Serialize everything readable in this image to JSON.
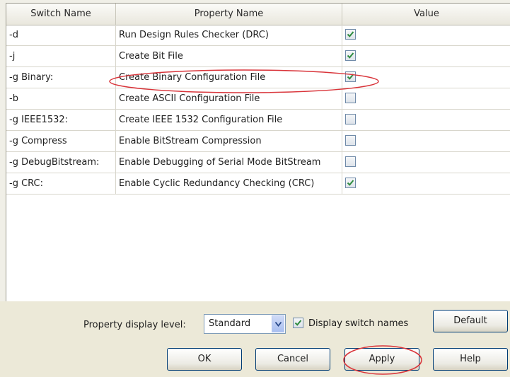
{
  "table": {
    "headers": [
      "Switch Name",
      "Property Name",
      "Value"
    ],
    "rows": [
      {
        "switch": "-d",
        "property": "Run Design Rules Checker (DRC)",
        "checked": true
      },
      {
        "switch": "-j",
        "property": "Create Bit File",
        "checked": true
      },
      {
        "switch": "-g Binary:",
        "property": "Create Binary Configuration File",
        "checked": true
      },
      {
        "switch": "-b",
        "property": "Create ASCII Configuration File",
        "checked": false
      },
      {
        "switch": "-g IEEE1532:",
        "property": "Create IEEE 1532 Configuration File",
        "checked": false
      },
      {
        "switch": "-g Compress",
        "property": "Enable BitStream Compression",
        "checked": false
      },
      {
        "switch": "-g DebugBitstream:",
        "property": "Enable Debugging of Serial Mode BitStream",
        "checked": false
      },
      {
        "switch": "-g CRC:",
        "property": "Enable Cyclic Redundancy Checking (CRC)",
        "checked": true
      }
    ]
  },
  "controls": {
    "display_level_label": "Property display level:",
    "display_level_value": "Standard",
    "display_switch_label": "Display switch names",
    "display_switch_checked": true,
    "default_label": "Default",
    "ok_label": "OK",
    "cancel_label": "Cancel",
    "apply_label": "Apply",
    "help_label": "Help"
  },
  "colors": {
    "annotation": "#d9343a",
    "check": "#2e8b3e"
  }
}
